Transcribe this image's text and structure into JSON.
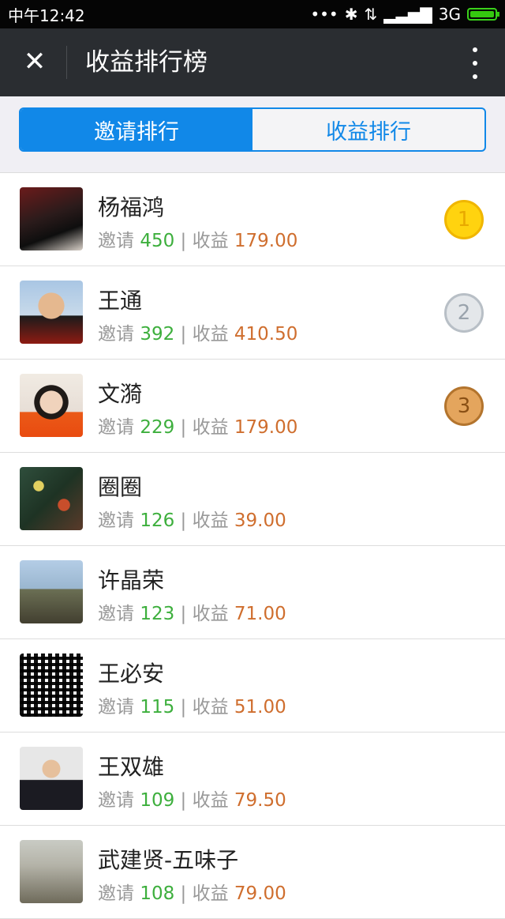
{
  "status_bar": {
    "time": "中午12:42",
    "network": "3G",
    "icons": [
      "dots-icon",
      "bluetooth-icon",
      "data-icon",
      "signal-icon",
      "battery-icon"
    ]
  },
  "header": {
    "title": "收益排行榜",
    "close_icon": "close-icon",
    "more_icon": "more-icon"
  },
  "tabs": [
    {
      "label": "邀请排行",
      "active": true
    },
    {
      "label": "收益排行",
      "active": false
    }
  ],
  "labels": {
    "invite": "邀请",
    "income": "收益",
    "separator": "|"
  },
  "rankings": [
    {
      "name": "杨福鸿",
      "invites": "450",
      "income": "179.00",
      "medal": "1"
    },
    {
      "name": "王通",
      "invites": "392",
      "income": "410.50",
      "medal": "2"
    },
    {
      "name": "文漪",
      "invites": "229",
      "income": "179.00",
      "medal": "3"
    },
    {
      "name": "圈圈",
      "invites": "126",
      "income": "39.00"
    },
    {
      "name": "许晶荣",
      "invites": "123",
      "income": "71.00"
    },
    {
      "name": "王必安",
      "invites": "115",
      "income": "51.00"
    },
    {
      "name": "王双雄",
      "invites": "109",
      "income": "79.50"
    },
    {
      "name": "武建贤-五味子",
      "invites": "108",
      "income": "79.00"
    }
  ],
  "colors": {
    "accent": "#1188e8",
    "invite_value": "#3daf3d",
    "income_value": "#cf6e2e",
    "navbar": "#2a2d31"
  }
}
